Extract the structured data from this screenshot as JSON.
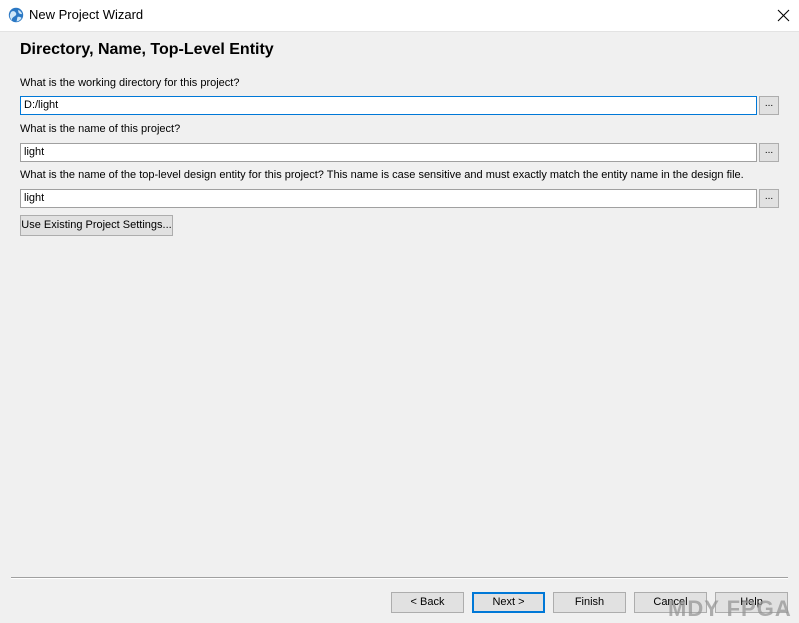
{
  "window": {
    "title": "New Project Wizard",
    "icon": "quartus-globe-icon",
    "close_glyph": "✕"
  },
  "page": {
    "heading": "Directory, Name, Top-Level Entity"
  },
  "fields": {
    "directory": {
      "label": "What is the working directory for this project?",
      "value": "D:/light",
      "browse_label": "..."
    },
    "project_name": {
      "label": "What is the name of this project?",
      "value": "light",
      "browse_label": "..."
    },
    "top_level_entity": {
      "label": "What is the name of the top-level design entity for this project? This name is case sensitive and must exactly match the entity name in the design file.",
      "value": "light",
      "browse_label": "..."
    }
  },
  "use_existing_label": "Use Existing Project Settings...",
  "buttons": {
    "back": "< Back",
    "next": "Next >",
    "finish": "Finish",
    "cancel": "Cancel",
    "help": "Help"
  },
  "watermark": "MDY FPGA",
  "colors": {
    "focus_blue": "#0078d7",
    "dialog_bg": "#f0f0f0",
    "button_bg": "#e1e1e1"
  }
}
